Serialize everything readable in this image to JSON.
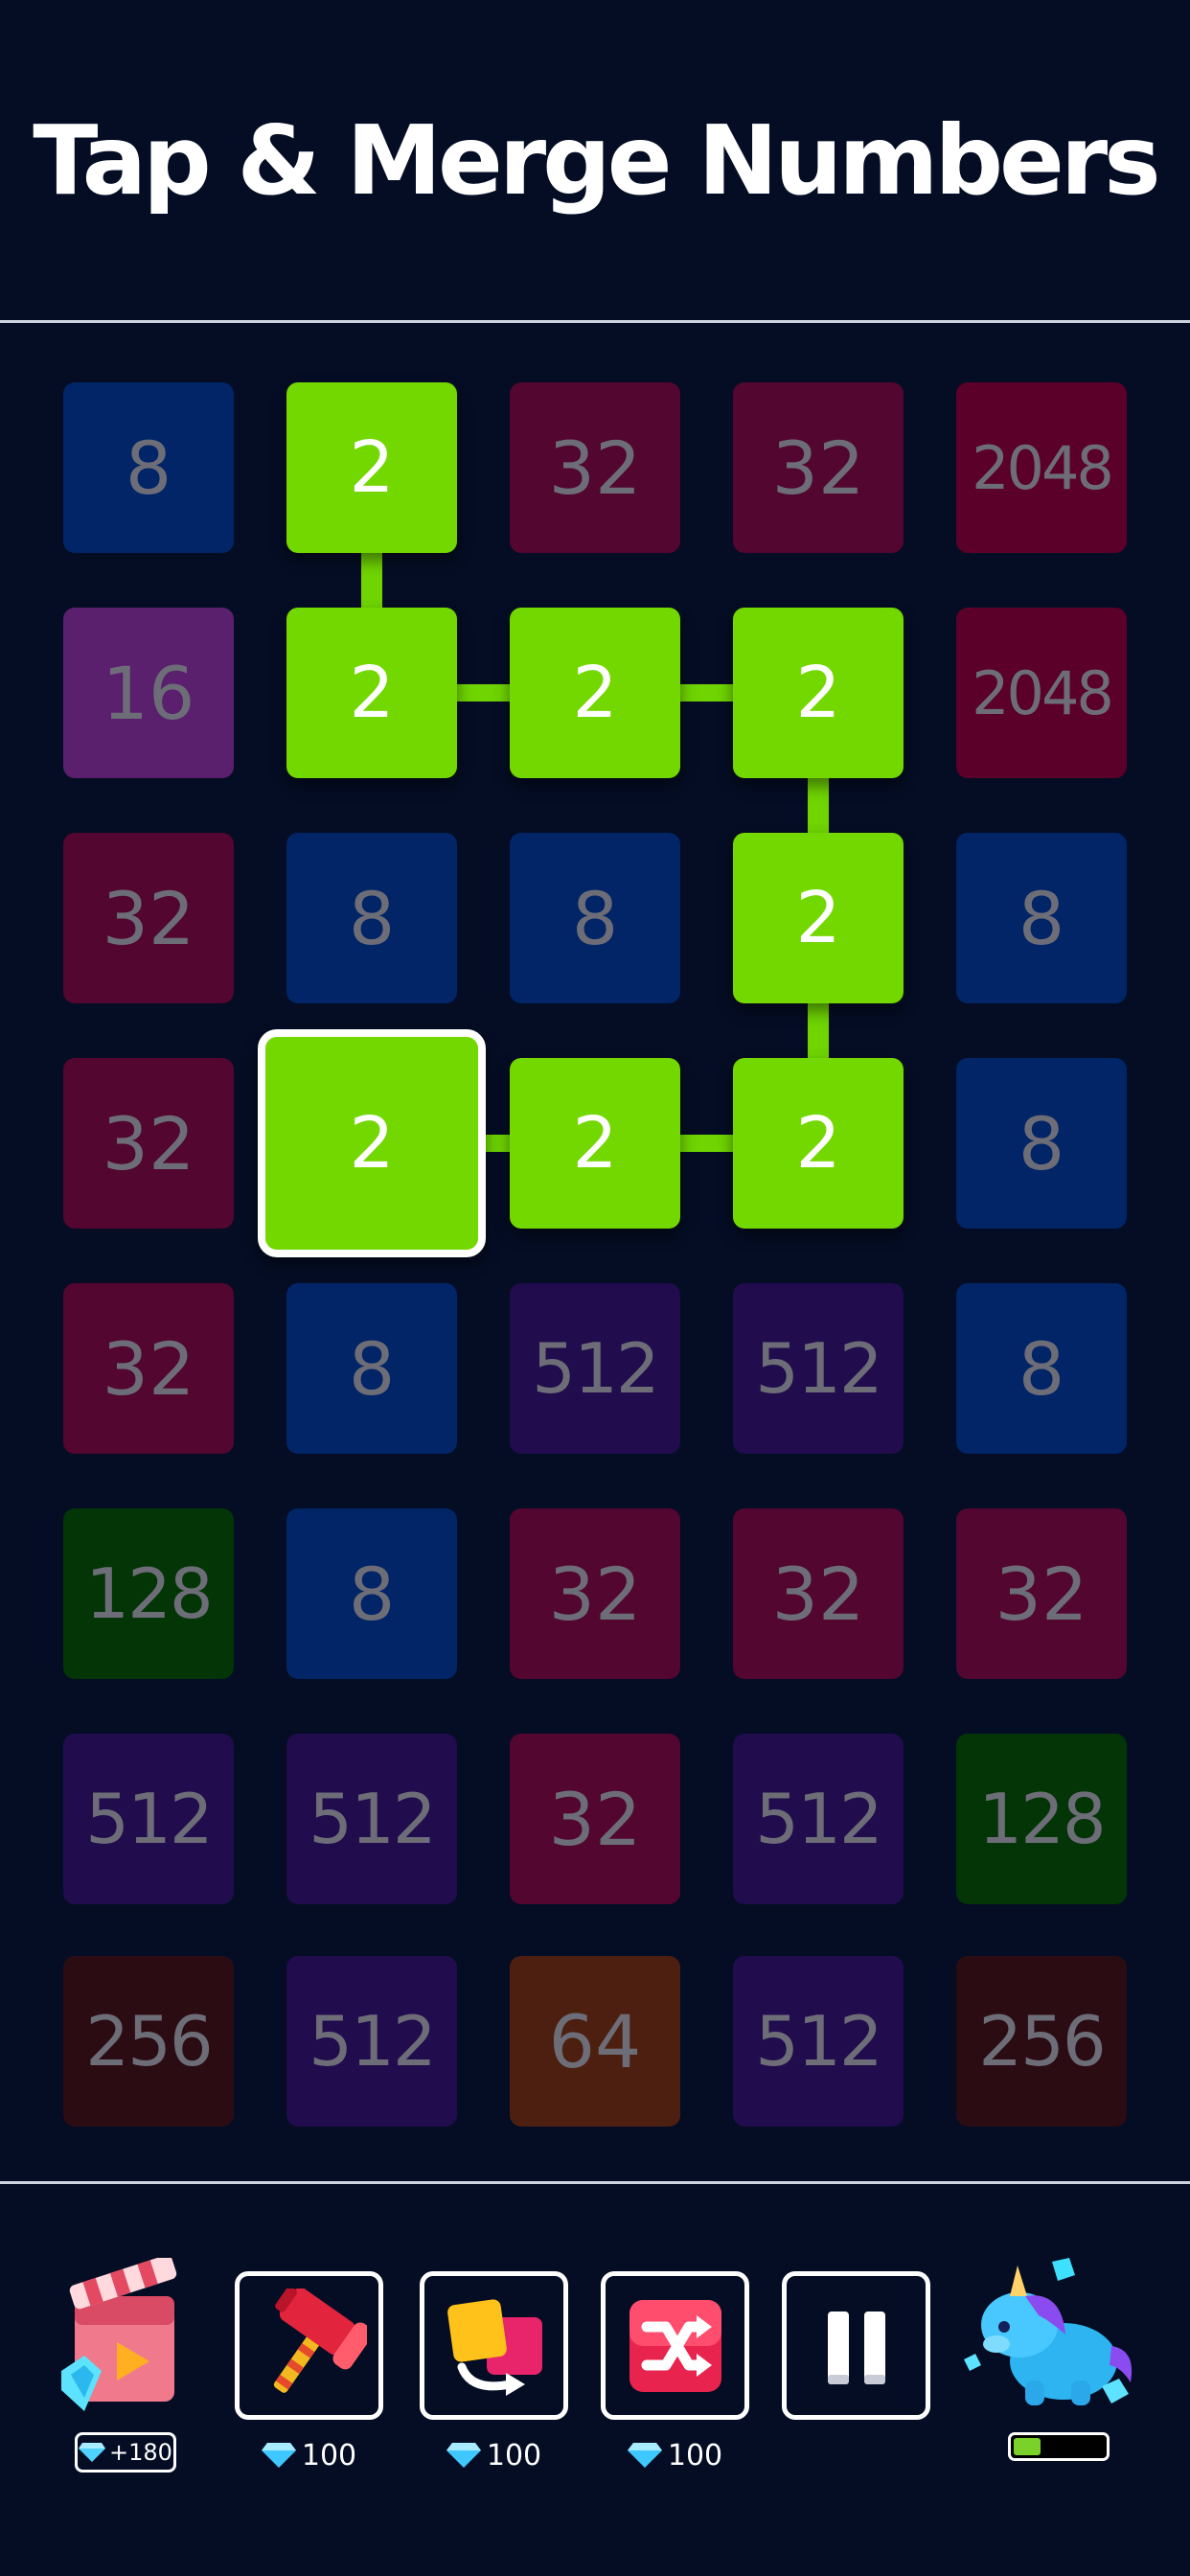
{
  "title": "Tap & Merge Numbers",
  "colors": {
    "active_tile": "#73d700",
    "tile_8": "#012567",
    "tile_16": "#5a1f6d",
    "tile_32": "#520630",
    "tile_64": "#4d1f10",
    "tile_128": "#033506",
    "tile_256": "#2b0c13",
    "tile_512": "#210c4d",
    "tile_2048": "#5a0029"
  },
  "grid": {
    "rows": [
      [
        {
          "value": "8",
          "kind": "8"
        },
        {
          "value": "2",
          "kind": "active"
        },
        {
          "value": "32",
          "kind": "32"
        },
        {
          "value": "32",
          "kind": "32"
        },
        {
          "value": "2048",
          "kind": "2048"
        }
      ],
      [
        {
          "value": "16",
          "kind": "16"
        },
        {
          "value": "2",
          "kind": "active"
        },
        {
          "value": "2",
          "kind": "active"
        },
        {
          "value": "2",
          "kind": "active"
        },
        {
          "value": "2048",
          "kind": "2048"
        }
      ],
      [
        {
          "value": "32",
          "kind": "32"
        },
        {
          "value": "8",
          "kind": "8"
        },
        {
          "value": "8",
          "kind": "8"
        },
        {
          "value": "2",
          "kind": "active"
        },
        {
          "value": "8",
          "kind": "8"
        }
      ],
      [
        {
          "value": "32",
          "kind": "32"
        },
        {
          "value": "2",
          "kind": "selected"
        },
        {
          "value": "2",
          "kind": "active"
        },
        {
          "value": "2",
          "kind": "active"
        },
        {
          "value": "8",
          "kind": "8"
        }
      ],
      [
        {
          "value": "32",
          "kind": "32"
        },
        {
          "value": "8",
          "kind": "8"
        },
        {
          "value": "512",
          "kind": "512"
        },
        {
          "value": "512",
          "kind": "512"
        },
        {
          "value": "8",
          "kind": "8"
        }
      ],
      [
        {
          "value": "128",
          "kind": "128"
        },
        {
          "value": "8",
          "kind": "8"
        },
        {
          "value": "32",
          "kind": "32"
        },
        {
          "value": "32",
          "kind": "32"
        },
        {
          "value": "32",
          "kind": "32"
        }
      ],
      [
        {
          "value": "512",
          "kind": "512"
        },
        {
          "value": "512",
          "kind": "512"
        },
        {
          "value": "32",
          "kind": "32"
        },
        {
          "value": "512",
          "kind": "512"
        },
        {
          "value": "128",
          "kind": "128"
        }
      ],
      [
        {
          "value": "256",
          "kind": "256"
        },
        {
          "value": "512",
          "kind": "512"
        },
        {
          "value": "64",
          "kind": "64"
        },
        {
          "value": "512",
          "kind": "512"
        },
        {
          "value": "256",
          "kind": "256"
        }
      ]
    ]
  },
  "toolbar": {
    "reward_video": {
      "label": "+180",
      "icon": "video-reward-icon"
    },
    "hammer": {
      "cost": "100",
      "icon": "hammer-icon"
    },
    "swap": {
      "cost": "100",
      "icon": "swap-icon"
    },
    "shuffle": {
      "cost": "100",
      "icon": "shuffle-icon"
    },
    "pause": {
      "icon": "pause-icon"
    },
    "mascot": {
      "icon": "unicorn-icon",
      "progress": 0.3
    }
  }
}
